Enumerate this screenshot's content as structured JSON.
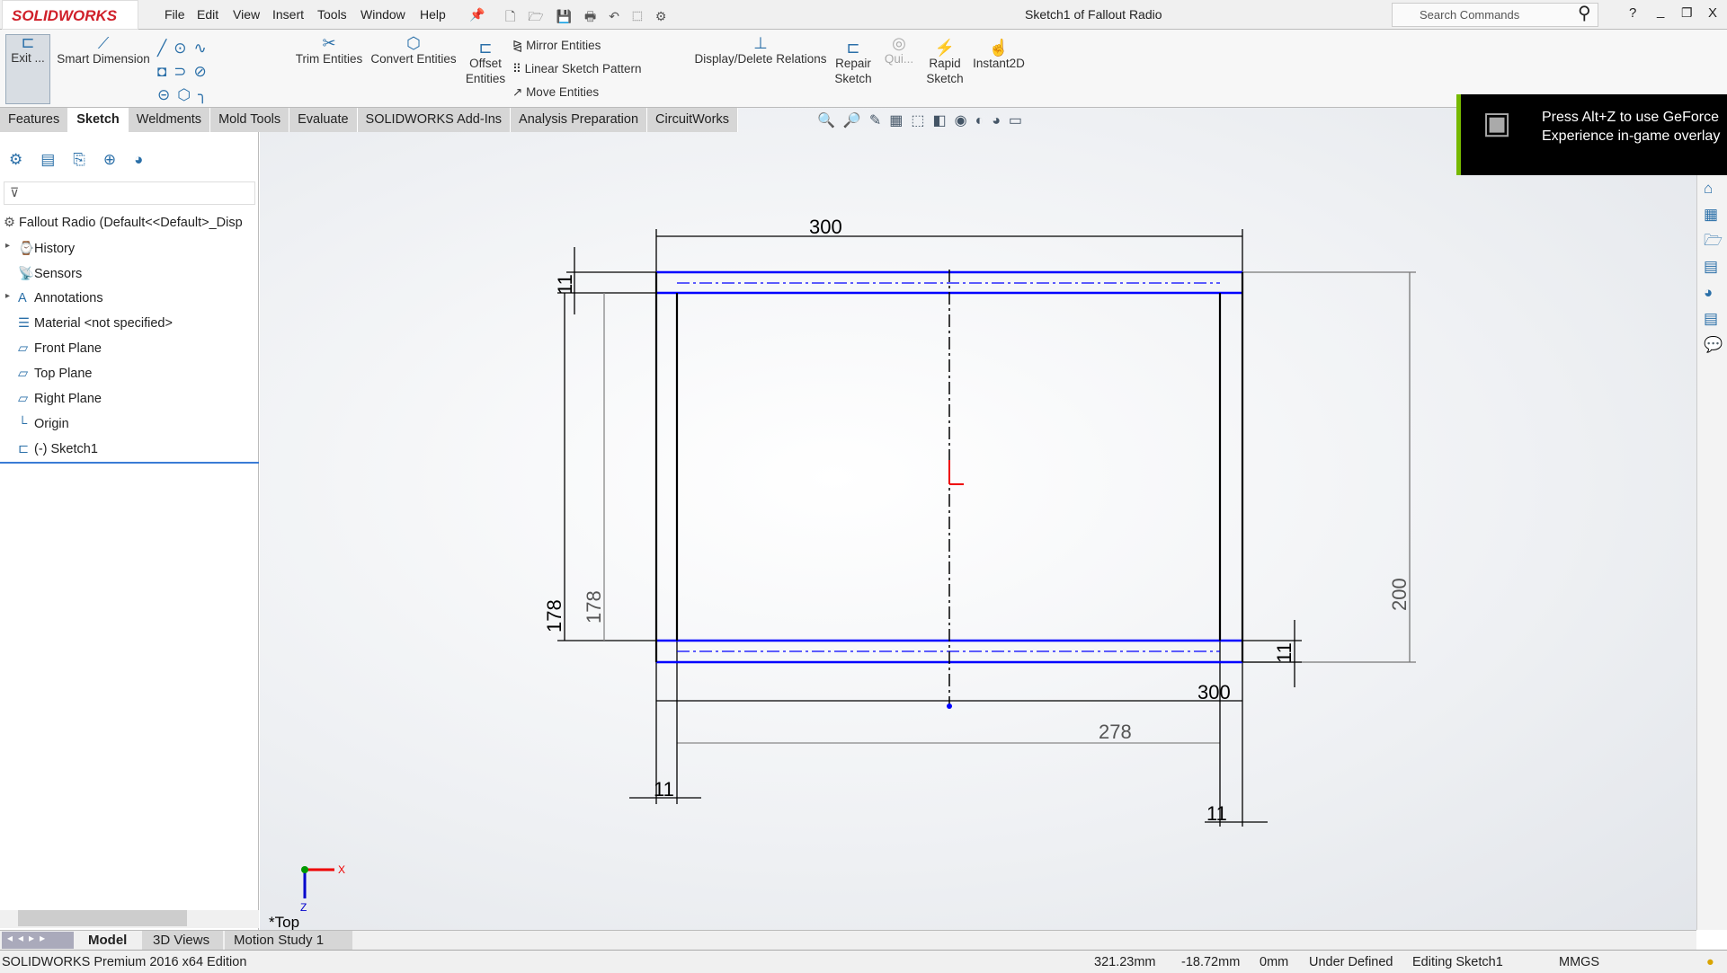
{
  "app": {
    "logo": "SOLIDWORKS",
    "title": "Sketch1 of Fallout Radio",
    "menu": [
      "File",
      "Edit",
      "View",
      "Insert",
      "Tools",
      "Window",
      "Help"
    ],
    "search_placeholder": "Search Commands"
  },
  "ribbon": {
    "exit": "Exit ...",
    "smart_dimension": "Smart Dimension",
    "trim": "Trim Entities",
    "convert": "Convert Entities",
    "offset1": "Offset",
    "offset2": "Entities",
    "mirror": "Mirror Entities",
    "linear": "Linear Sketch Pattern",
    "move": "Move Entities",
    "relations": "Display/Delete Relations",
    "repair1": "Repair",
    "repair2": "Sketch",
    "quick": "Qui...",
    "rapid1": "Rapid",
    "rapid2": "Sketch",
    "instant2d": "Instant2D"
  },
  "tabs": [
    "Features",
    "Sketch",
    "Weldments",
    "Mold Tools",
    "Evaluate",
    "SOLIDWORKS Add-Ins",
    "Analysis Preparation",
    "CircuitWorks"
  ],
  "active_tab": "Sketch",
  "tree": {
    "root": "Fallout Radio  (Default<<Default>_Disp",
    "items": [
      "History",
      "Sensors",
      "Annotations",
      "Material <not specified>",
      "Front Plane",
      "Top Plane",
      "Right Plane",
      "Origin",
      "(-) Sketch1"
    ]
  },
  "overlay": {
    "text": "Press Alt+Z to use GeForce Experience in-game overlay"
  },
  "sketch": {
    "dims": {
      "top_width": "300",
      "bottom_width": "300",
      "inner_width": "278",
      "height_right": "200",
      "height_left": "178",
      "height_left_driven": "178",
      "thick_top_left": "11",
      "thick_right": "11",
      "thick_bottom_left": "11",
      "thick_bottom_right": "11"
    },
    "view_label": "*Top",
    "axis_x": "X",
    "axis_z": "Z",
    "color_sketch": "#0000ff"
  },
  "bottom_tabs": [
    "Model",
    "3D Views",
    "Motion Study 1"
  ],
  "status": {
    "edition": "SOLIDWORKS Premium 2016 x64 Edition",
    "x": "321.23mm",
    "y": "-18.72mm",
    "z": "0mm",
    "state": "Under Defined",
    "editing": "Editing Sketch1",
    "units": "MMGS"
  }
}
